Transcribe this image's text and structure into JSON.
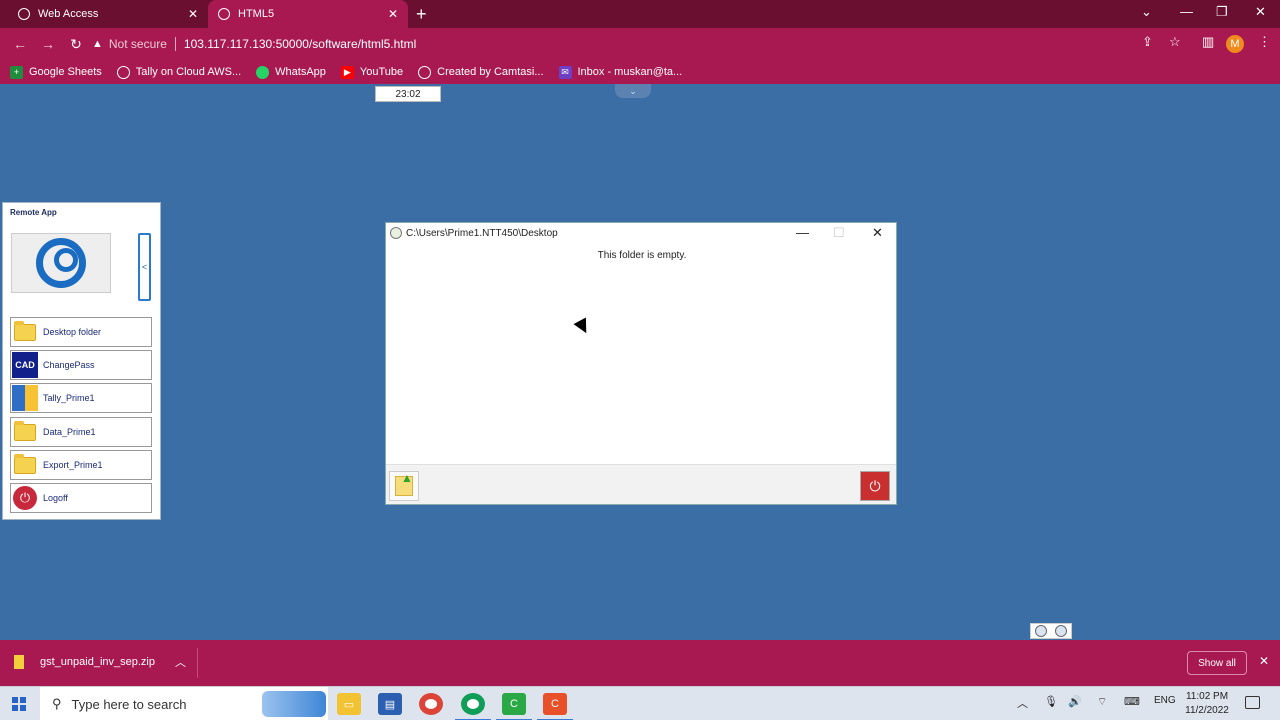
{
  "browser": {
    "tabs": [
      {
        "label": "Web Access"
      },
      {
        "label": "HTML5"
      }
    ],
    "address": {
      "security": "Not secure",
      "url": "103.117.117.130:50000/software/html5.html"
    },
    "profile_initial": "M",
    "bookmarks": [
      {
        "label": "Google Sheets",
        "color": "#1e8e3e"
      },
      {
        "label": "Tally on Cloud AWS...",
        "color": "#444444"
      },
      {
        "label": "WhatsApp",
        "color": "#25d366"
      },
      {
        "label": "YouTube",
        "color": "#ff0000"
      },
      {
        "label": "Created by Camtasi...",
        "color": "#444444"
      },
      {
        "label": "Inbox - muskan@ta...",
        "color": "#6c3fc4"
      }
    ]
  },
  "remote": {
    "time_chip": "23:02",
    "panel": {
      "title": "Remote App",
      "apps": [
        {
          "label": "Desktop folder",
          "icon": "folder-icon"
        },
        {
          "label": "ChangePass",
          "icon": "cad-icon",
          "icon_text": "CAD"
        },
        {
          "label": "Tally_Prime1",
          "icon": "tally-icon"
        },
        {
          "label": "Data_Prime1",
          "icon": "folder-icon"
        },
        {
          "label": "Export_Prime1",
          "icon": "folder-icon"
        },
        {
          "label": "Logoff",
          "icon": "power-icon"
        }
      ]
    },
    "explorer": {
      "title": "C:\\Users\\Prime1.NTT450\\Desktop",
      "message": "This folder is empty."
    }
  },
  "downloads": {
    "file": "gst_unpaid_inv_sep.zip",
    "show_all": "Show all"
  },
  "taskbar": {
    "search_placeholder": "Type here to search",
    "lang": "ENG",
    "time": "11:02 PM",
    "date": "11/2/2022"
  },
  "colors": {
    "browser_frame": "#a81952",
    "tab_strip": "#6a0f30",
    "desktop": "#3a6ea5"
  }
}
